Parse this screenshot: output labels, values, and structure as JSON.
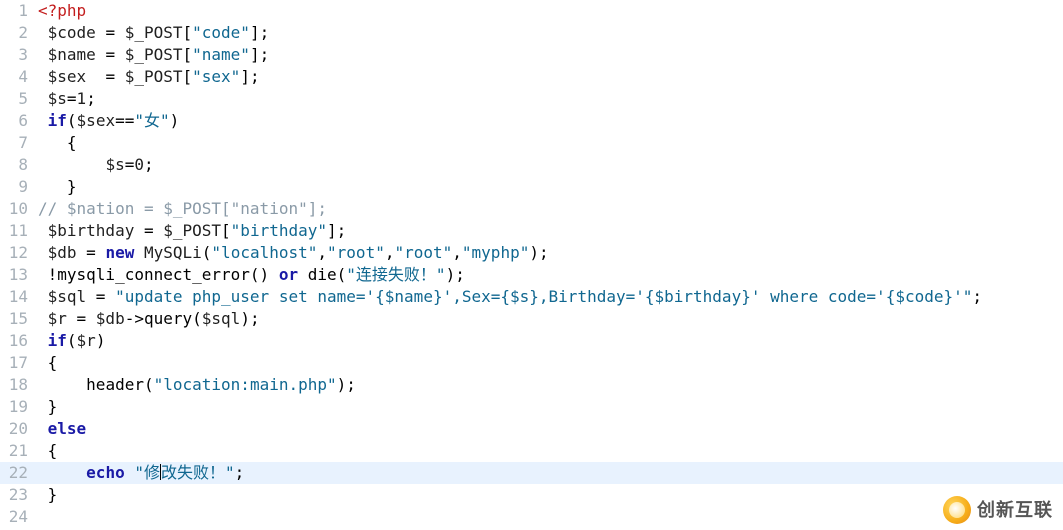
{
  "watermark": {
    "text": "创新互联"
  },
  "highlighted_line": 22,
  "lines": [
    {
      "n": 1,
      "tokens": [
        [
          "tk-php",
          "<?php"
        ]
      ]
    },
    {
      "n": 2,
      "tokens": [
        [
          "tk-var",
          " $code "
        ],
        [
          "tk-punc",
          "= "
        ],
        [
          "tk-var",
          "$_POST"
        ],
        [
          "tk-punc",
          "["
        ],
        [
          "tk-str",
          "\"code\""
        ],
        [
          "tk-punc",
          "];"
        ]
      ]
    },
    {
      "n": 3,
      "tokens": [
        [
          "tk-var",
          " $name "
        ],
        [
          "tk-punc",
          "= "
        ],
        [
          "tk-var",
          "$_POST"
        ],
        [
          "tk-punc",
          "["
        ],
        [
          "tk-str",
          "\"name\""
        ],
        [
          "tk-punc",
          "];"
        ]
      ]
    },
    {
      "n": 4,
      "tokens": [
        [
          "tk-var",
          " $sex  "
        ],
        [
          "tk-punc",
          "= "
        ],
        [
          "tk-var",
          "$_POST"
        ],
        [
          "tk-punc",
          "["
        ],
        [
          "tk-str",
          "\"sex\""
        ],
        [
          "tk-punc",
          "];"
        ]
      ]
    },
    {
      "n": 5,
      "tokens": [
        [
          "tk-var",
          " $s"
        ],
        [
          "tk-punc",
          "="
        ],
        [
          "tk-lit",
          "1"
        ],
        [
          "tk-punc",
          ";"
        ]
      ]
    },
    {
      "n": 6,
      "tokens": [
        [
          "tk-punc",
          " "
        ],
        [
          "tk-kw",
          "if"
        ],
        [
          "tk-punc",
          "("
        ],
        [
          "tk-var",
          "$sex"
        ],
        [
          "tk-punc",
          "=="
        ],
        [
          "tk-str",
          "\"女\""
        ],
        [
          "tk-punc",
          ")"
        ]
      ]
    },
    {
      "n": 7,
      "tokens": [
        [
          "tk-punc",
          "   {"
        ]
      ]
    },
    {
      "n": 8,
      "tokens": [
        [
          "tk-punc",
          "       "
        ],
        [
          "tk-var",
          "$s"
        ],
        [
          "tk-punc",
          "="
        ],
        [
          "tk-lit",
          "0"
        ],
        [
          "tk-punc",
          ";"
        ]
      ]
    },
    {
      "n": 9,
      "tokens": [
        [
          "tk-punc",
          "   }"
        ]
      ]
    },
    {
      "n": 10,
      "tokens": [
        [
          "tk-cmt",
          "// $nation = $_POST[\"nation\"];"
        ]
      ]
    },
    {
      "n": 11,
      "tokens": [
        [
          "tk-var",
          " $birthday "
        ],
        [
          "tk-punc",
          "= "
        ],
        [
          "tk-var",
          "$_POST"
        ],
        [
          "tk-punc",
          "["
        ],
        [
          "tk-str",
          "\"birthday\""
        ],
        [
          "tk-punc",
          "];"
        ]
      ]
    },
    {
      "n": 12,
      "tokens": [
        [
          "tk-var",
          " $db "
        ],
        [
          "tk-punc",
          "= "
        ],
        [
          "tk-kw",
          "new"
        ],
        [
          "tk-punc",
          " "
        ],
        [
          "tk-class",
          "MySQLi"
        ],
        [
          "tk-punc",
          "("
        ],
        [
          "tk-str",
          "\"localhost\""
        ],
        [
          "tk-punc",
          ","
        ],
        [
          "tk-str",
          "\"root\""
        ],
        [
          "tk-punc",
          ","
        ],
        [
          "tk-str",
          "\"root\""
        ],
        [
          "tk-punc",
          ","
        ],
        [
          "tk-str",
          "\"myphp\""
        ],
        [
          "tk-punc",
          ");"
        ]
      ]
    },
    {
      "n": 13,
      "tokens": [
        [
          "tk-punc",
          " !"
        ],
        [
          "tk-func",
          "mysqli_connect_error"
        ],
        [
          "tk-punc",
          "() "
        ],
        [
          "tk-kw",
          "or"
        ],
        [
          "tk-punc",
          " "
        ],
        [
          "tk-func",
          "die"
        ],
        [
          "tk-punc",
          "("
        ],
        [
          "tk-str",
          "\"连接失败！\""
        ],
        [
          "tk-punc",
          ");"
        ]
      ]
    },
    {
      "n": 14,
      "tokens": [
        [
          "tk-var",
          " $sql "
        ],
        [
          "tk-punc",
          "= "
        ],
        [
          "tk-str",
          "\"update php_user set name='{$name}',Sex={$s},Birthday='{$birthday}' where code='{$code}'\""
        ],
        [
          "tk-punc",
          ";"
        ]
      ]
    },
    {
      "n": 15,
      "tokens": [
        [
          "tk-var",
          " $r "
        ],
        [
          "tk-punc",
          "= "
        ],
        [
          "tk-var",
          "$db"
        ],
        [
          "tk-punc",
          "->"
        ],
        [
          "tk-func",
          "query"
        ],
        [
          "tk-punc",
          "("
        ],
        [
          "tk-var",
          "$sql"
        ],
        [
          "tk-punc",
          ");"
        ]
      ]
    },
    {
      "n": 16,
      "tokens": [
        [
          "tk-punc",
          " "
        ],
        [
          "tk-kw",
          "if"
        ],
        [
          "tk-punc",
          "("
        ],
        [
          "tk-var",
          "$r"
        ],
        [
          "tk-punc",
          ")"
        ]
      ]
    },
    {
      "n": 17,
      "tokens": [
        [
          "tk-punc",
          " {"
        ]
      ]
    },
    {
      "n": 18,
      "tokens": [
        [
          "tk-punc",
          "     "
        ],
        [
          "tk-func",
          "header"
        ],
        [
          "tk-punc",
          "("
        ],
        [
          "tk-str",
          "\"location:main.php\""
        ],
        [
          "tk-punc",
          ");"
        ]
      ]
    },
    {
      "n": 19,
      "tokens": [
        [
          "tk-punc",
          " }"
        ]
      ]
    },
    {
      "n": 20,
      "tokens": [
        [
          "tk-punc",
          " "
        ],
        [
          "tk-kw",
          "else"
        ]
      ]
    },
    {
      "n": 21,
      "tokens": [
        [
          "tk-punc",
          " {"
        ]
      ]
    },
    {
      "n": 22,
      "tokens": [
        [
          "tk-punc",
          "     "
        ],
        [
          "tk-kw",
          "echo"
        ],
        [
          "tk-punc",
          " "
        ],
        [
          "tk-str",
          "\"修"
        ],
        [
          "caret",
          ""
        ],
        [
          "tk-str",
          "改失败！\""
        ],
        [
          "tk-punc",
          ";"
        ]
      ]
    },
    {
      "n": 23,
      "tokens": [
        [
          "tk-punc",
          " }"
        ]
      ]
    },
    {
      "n": 24,
      "tokens": [
        [
          "tk-punc",
          ""
        ]
      ]
    }
  ]
}
